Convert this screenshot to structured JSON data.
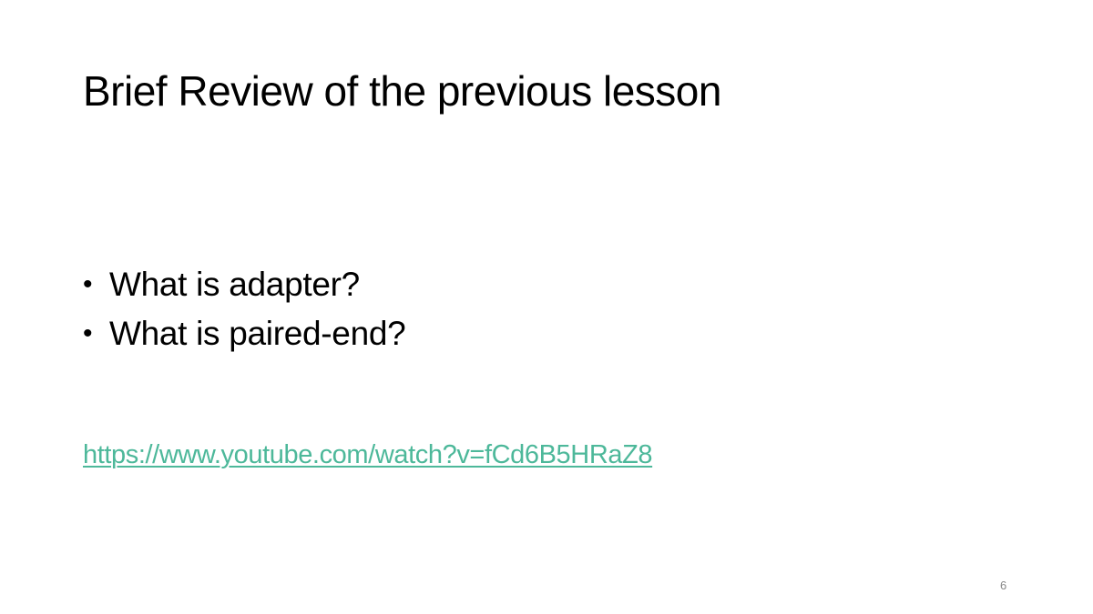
{
  "slide": {
    "title": "Brief Review of the previous lesson",
    "bullets": [
      {
        "marker": "•",
        "text": "What is adapter?"
      },
      {
        "marker": "•",
        "text": "What is paired-end?"
      }
    ],
    "link": {
      "text": "https://www.youtube.com/watch?v=fCd6B5HRaZ8",
      "href": "https://www.youtube.com/watch?v=fCd6B5HRaZ8",
      "color": "#4db89a"
    },
    "page_number": "6"
  }
}
